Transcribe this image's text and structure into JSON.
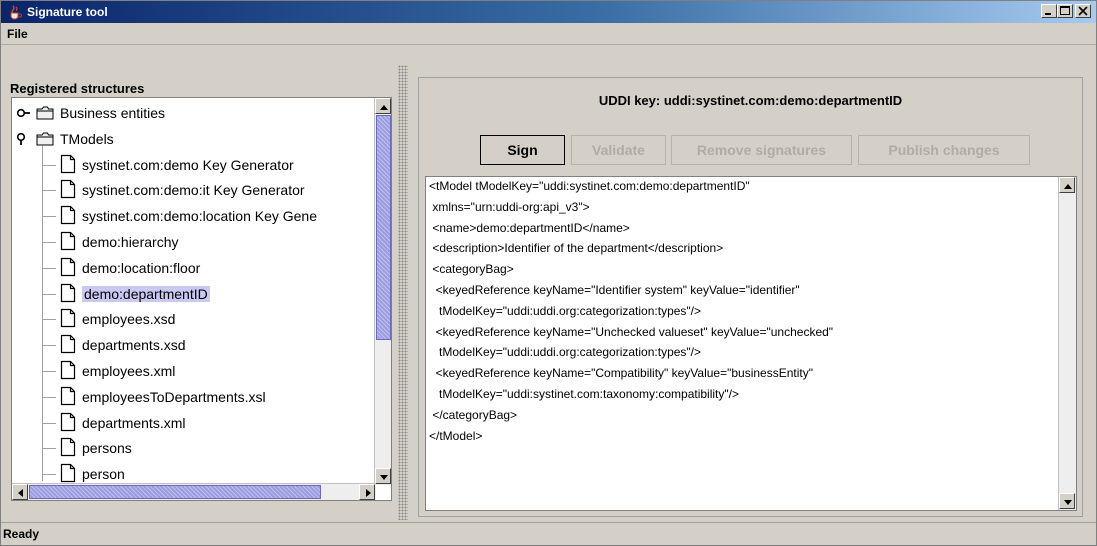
{
  "window": {
    "title": "Signature tool"
  },
  "menu": {
    "file": "File"
  },
  "left": {
    "title": "Registered structures",
    "tree": [
      {
        "label": "Business entities",
        "kind": "folder",
        "expanded": false,
        "level": 0
      },
      {
        "label": "TModels",
        "kind": "folder",
        "expanded": true,
        "level": 0
      },
      {
        "label": "systinet.com:demo Key Generator",
        "kind": "doc",
        "level": 1
      },
      {
        "label": "systinet.com:demo:it Key Generator",
        "kind": "doc",
        "level": 1
      },
      {
        "label": "systinet.com:demo:location Key Gene",
        "kind": "doc",
        "level": 1
      },
      {
        "label": "demo:hierarchy",
        "kind": "doc",
        "level": 1
      },
      {
        "label": "demo:location:floor",
        "kind": "doc",
        "level": 1
      },
      {
        "label": "demo:departmentID",
        "kind": "doc",
        "level": 1,
        "selected": true
      },
      {
        "label": "employees.xsd",
        "kind": "doc",
        "level": 1
      },
      {
        "label": "departments.xsd",
        "kind": "doc",
        "level": 1
      },
      {
        "label": "employees.xml",
        "kind": "doc",
        "level": 1
      },
      {
        "label": "employeesToDepartments.xsl",
        "kind": "doc",
        "level": 1
      },
      {
        "label": "departments.xml",
        "kind": "doc",
        "level": 1
      },
      {
        "label": "persons",
        "kind": "doc",
        "level": 1
      },
      {
        "label": "person",
        "kind": "doc",
        "level": 1
      }
    ]
  },
  "right": {
    "uddi_key": "UDDI key:  uddi:systinet.com:demo:departmentID",
    "buttons": {
      "sign": "Sign",
      "validate": "Validate",
      "remove": "Remove signatures",
      "publish": "Publish changes"
    },
    "xml_lines": [
      "<tModel tModelKey=\"uddi:systinet.com:demo:departmentID\"",
      " xmlns=\"urn:uddi-org:api_v3\">",
      " <name>demo:departmentID</name>",
      " <description>Identifier of the department</description>",
      " <categoryBag>",
      "  <keyedReference keyName=\"Identifier system\" keyValue=\"identifier\"",
      "   tModelKey=\"uddi:uddi.org:categorization:types\"/>",
      "  <keyedReference keyName=\"Unchecked valueset\" keyValue=\"unchecked\"",
      "   tModelKey=\"uddi:uddi.org:categorization:types\"/>",
      "  <keyedReference keyName=\"Compatibility\" keyValue=\"businessEntity\"",
      "   tModelKey=\"uddi:systinet.com:taxonomy:compatibility\"/>",
      " </categoryBag>",
      "</tModel>"
    ]
  },
  "status": {
    "text": "Ready"
  }
}
